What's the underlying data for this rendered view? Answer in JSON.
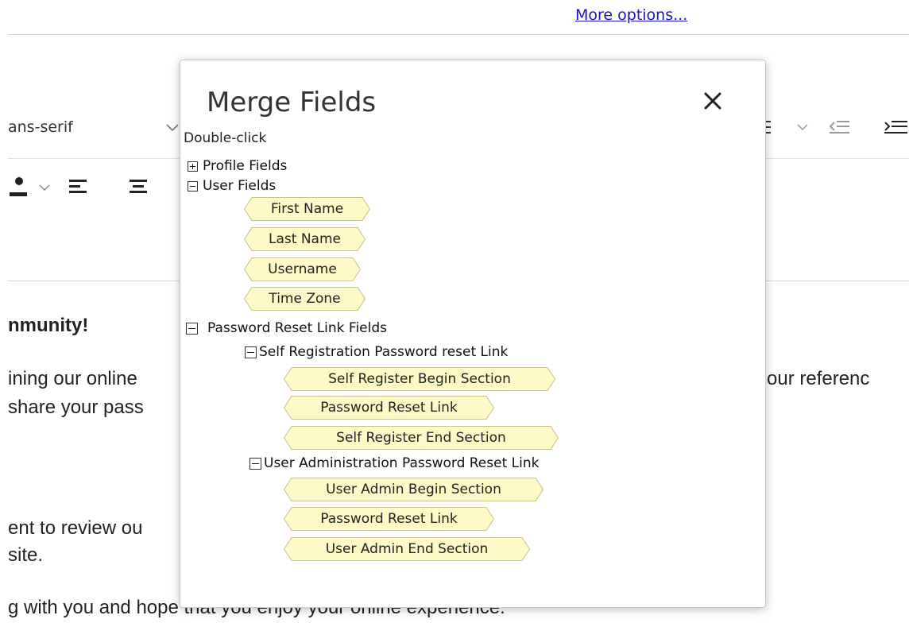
{
  "header": {
    "more_options": "More options..."
  },
  "toolbar": {
    "font_family": "ans-serif"
  },
  "editor": {
    "lines": [
      "nmunity!",
      "ining our online",
      "share your pass",
      "our referenc",
      "ent to review ou",
      "site.",
      "g with you and hope that you enjoy your online experience."
    ]
  },
  "dialog": {
    "title": "Merge Fields",
    "hint": "Double-click",
    "groups": {
      "profile": "Profile Fields",
      "user": "User Fields",
      "password_reset": "Password Reset Link Fields",
      "self_registration": "Self Registration Password reset Link",
      "user_admin": "User Administration Password Reset Link"
    },
    "user_fields": [
      "First Name",
      "Last Name",
      "Username",
      "Time Zone"
    ],
    "self_registration_fields": [
      "Self Register Begin Section",
      "Password Reset Link",
      "Self Register End Section"
    ],
    "user_admin_fields": [
      "User Admin Begin Section",
      "Password Reset Link",
      "User Admin End Section"
    ]
  },
  "colors": {
    "chip_fill": "#fdfac8",
    "chip_border": "#c9c08a",
    "link": "#1a14c9"
  }
}
